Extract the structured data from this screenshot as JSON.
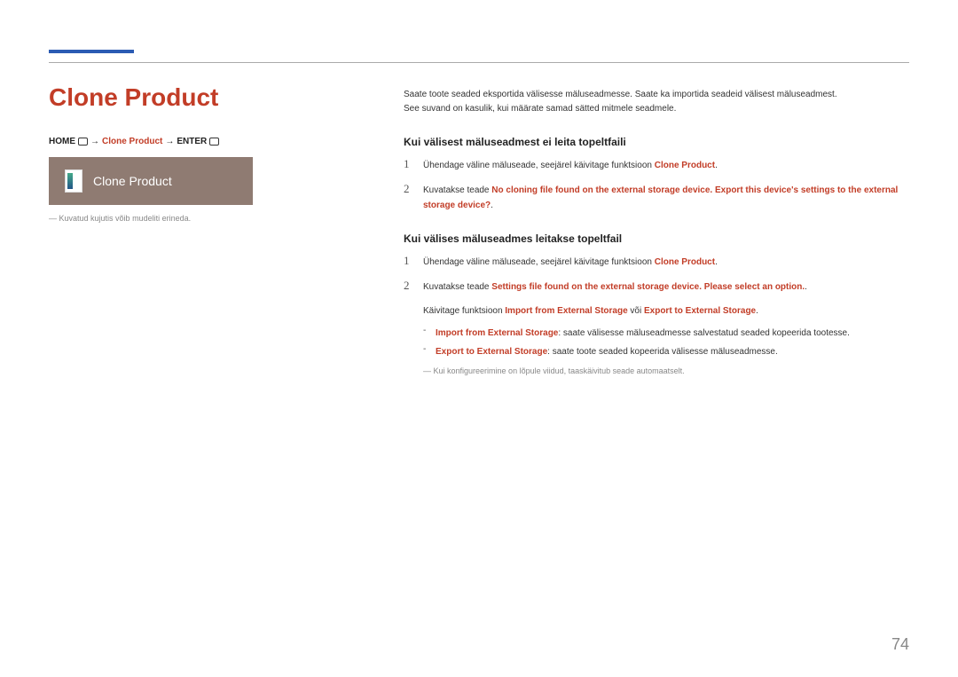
{
  "title": "Clone Product",
  "breadcrumb": {
    "home": "HOME",
    "arrow1": "→",
    "clone": "Clone Product",
    "arrow2": "→",
    "enter": "ENTER"
  },
  "screenshot_label": "Clone Product",
  "note_left": "Kuvatud kujutis võib mudeliti erineda.",
  "intro_1": "Saate toote seaded eksportida välisesse mäluseadmesse. Saate ka importida seadeid välisest mäluseadmest.",
  "intro_2": "See suvand on kasulik, kui määrate samad sätted mitmele seadmele.",
  "section1": {
    "header": "Kui välisest mäluseadmest ei leita topeltfaili",
    "step1_a": "Ühendage väline mäluseade, seejärel käivitage funktsioon ",
    "step1_hl": "Clone Product",
    "step1_b": ".",
    "step2_a": "Kuvatakse teade ",
    "step2_hl": "No cloning file found on the external storage device. Export this device's settings to the external storage device?",
    "step2_b": "."
  },
  "section2": {
    "header": "Kui välises mäluseadmes leitakse topeltfail",
    "step1_a": "Ühendage väline mäluseade, seejärel käivitage funktsioon ",
    "step1_hl": "Clone Product",
    "step1_b": ".",
    "step2_a": "Kuvatakse teade ",
    "step2_hl": "Settings file found on the external storage device. Please select an option.",
    "step2_b": ".",
    "launch_a": "Käivitage funktsioon ",
    "launch_hl1": "Import from External Storage",
    "launch_mid": " või ",
    "launch_hl2": "Export to External Storage",
    "launch_b": ".",
    "sub1_hl": "Import from External Storage",
    "sub1_b": ": saate välisesse mäluseadmesse salvestatud seaded kopeerida tootesse.",
    "sub2_hl": "Export to External Storage",
    "sub2_b": ": saate toote seaded kopeerida välisesse mäluseadmesse.",
    "final": "Kui konfigureerimine on lõpule viidud, taaskäivitub seade automaatselt."
  },
  "page": "74"
}
